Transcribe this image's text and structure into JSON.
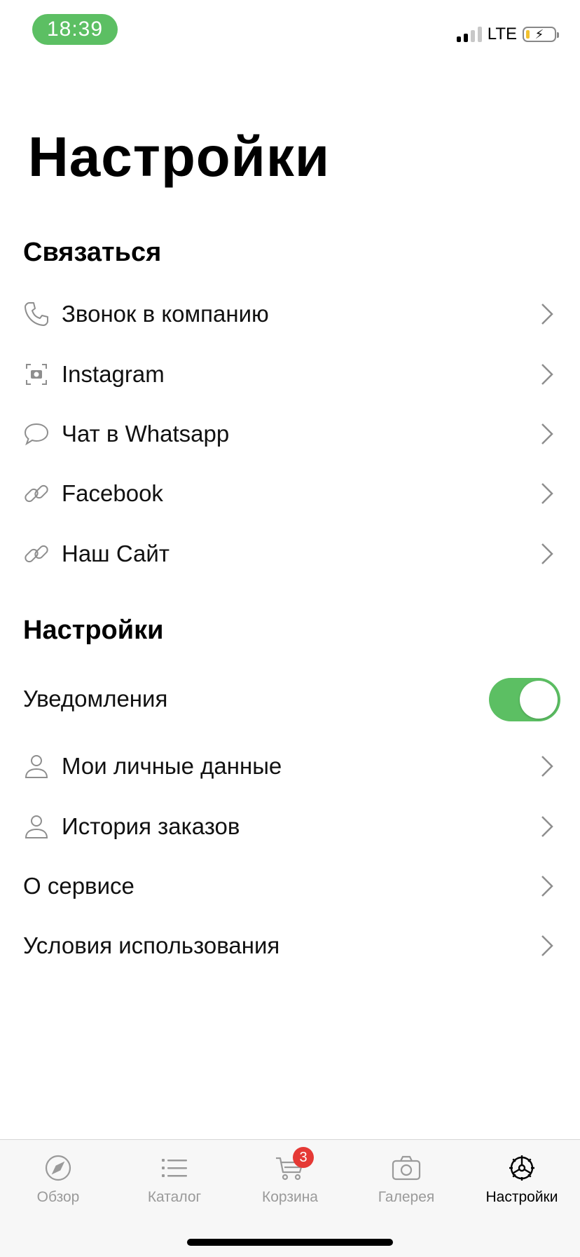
{
  "status_bar": {
    "time": "18:39",
    "network": "LTE",
    "accent_color": "#5cbf63"
  },
  "page": {
    "title": "Настройки"
  },
  "contact_section": {
    "title": "Связаться",
    "items": [
      {
        "label": "Звонок в компанию",
        "icon": "phone-icon"
      },
      {
        "label": "Instagram",
        "icon": "camera-icon"
      },
      {
        "label": "Чат в Whatsapp",
        "icon": "chat-bubble-icon"
      },
      {
        "label": "Facebook",
        "icon": "link-icon"
      },
      {
        "label": "Наш Сайт",
        "icon": "link-icon"
      }
    ]
  },
  "settings_section": {
    "title": "Настройки",
    "notifications": {
      "label": "Уведомления",
      "enabled": true
    },
    "items": [
      {
        "label": "Мои личные данные",
        "icon": "person-icon"
      },
      {
        "label": "История заказов",
        "icon": "person-icon"
      },
      {
        "label": "О сервисе",
        "icon": null
      },
      {
        "label": "Условия использования",
        "icon": null
      }
    ]
  },
  "tab_bar": {
    "tabs": [
      {
        "label": "Обзор",
        "icon": "compass-icon",
        "active": false
      },
      {
        "label": "Каталог",
        "icon": "list-icon",
        "active": false
      },
      {
        "label": "Корзина",
        "icon": "cart-icon",
        "active": false,
        "badge": "3"
      },
      {
        "label": "Галерея",
        "icon": "photo-camera-icon",
        "active": false
      },
      {
        "label": "Настройки",
        "icon": "settings-gear-icon",
        "active": true
      }
    ]
  }
}
